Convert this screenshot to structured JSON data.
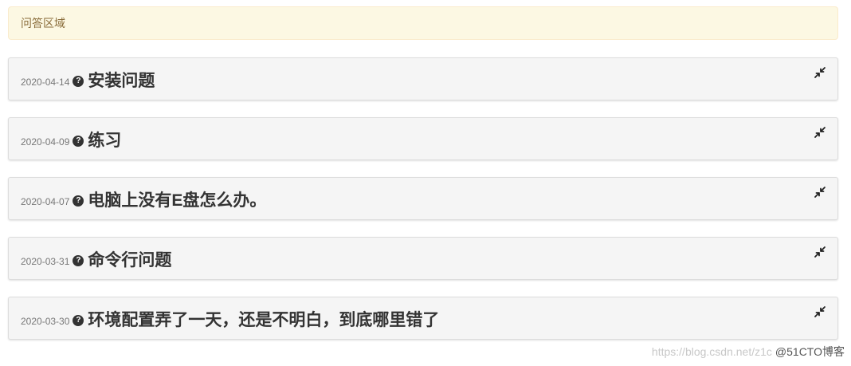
{
  "section": {
    "title": "问答区域"
  },
  "questions": [
    {
      "date": "2020-04-14",
      "title": "安装问题",
      "icon": "question-circle-icon"
    },
    {
      "date": "2020-04-09",
      "title": "练习",
      "icon": "question-circle-icon"
    },
    {
      "date": "2020-04-07",
      "title": "电脑上没有E盘怎么办。",
      "icon": "question-circle-icon"
    },
    {
      "date": "2020-03-31",
      "title": "命令行问题",
      "icon": "question-circle-icon"
    },
    {
      "date": "2020-03-30",
      "title": "环境配置弄了一天，还是不明白，到底哪里错了",
      "icon": "question-circle-icon"
    }
  ],
  "toggle_icon": "compress-icon",
  "watermark": {
    "url": "https://blog.csdn.net/z1c",
    "brand": "@51CTO博客"
  }
}
